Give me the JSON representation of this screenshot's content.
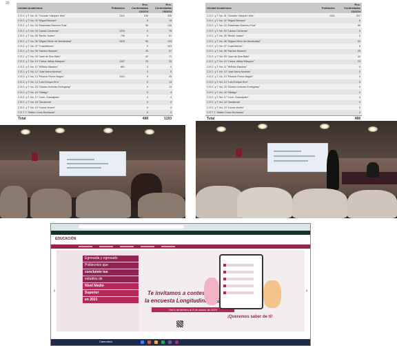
{
  "page_number": "20",
  "table_left": {
    "headers": [
      "Unidad Académica",
      "Población",
      "Enc. Contestadas 12/2/24",
      "Enc. Contestadas 19/2/24"
    ],
    "rows": [
      [
        "C.E.C. y T. No. 01 \"Gonzalo Vázquez Vela\"",
        "1341",
        "249",
        "335"
      ],
      [
        "C.E.C. y T. No. 02 \"Miguel Bernard\"",
        "",
        "8",
        "18"
      ],
      [
        "C.E.C. y T. No. 03 \"Estanislao Ramírez Ruiz\"",
        "",
        "96",
        "145"
      ],
      [
        "C.E.C. y T. No. 04 \"Lázaro Cárdenas\"",
        "1233",
        "0",
        "78"
      ],
      [
        "C.E.C. y T. No. 05 \"Benito Juárez\"",
        "795",
        "0",
        "51"
      ],
      [
        "C.E.C. y T. No. 06 \"Miguel Othón de Mendizábal\"",
        "1029",
        "90",
        "133"
      ],
      [
        "C.E.C. y T. No. 07 \"Cuauhtémoc\"",
        "",
        "0",
        "103"
      ],
      [
        "C.E.C. y T. No. 08 \"Narciso Bassols\"",
        "",
        "25",
        "57"
      ],
      [
        "C.E.C. y T. No. 09 \"Juan de Dios Bátiz\"",
        "",
        "42",
        "71"
      ],
      [
        "C.E.C. y T. No. 10 \"Carlos Vallejo Márquez\"",
        "1197",
        "23",
        "25"
      ],
      [
        "C.E.C. y T. No. 11 \"Wilfrido Massieu\"",
        "861",
        "0",
        "0"
      ],
      [
        "C.E.C. y T. No. 12 \"José María Morelos\"",
        "",
        "0",
        "0"
      ],
      [
        "C.E.C. y T. No. 13 \"Ricardo Flores Magón\"",
        "1121",
        "0",
        "29"
      ],
      [
        "C.E.C. y T. No. 14 \"Luis Enrique Erro\"",
        "",
        "0",
        "13"
      ],
      [
        "C.E.C. y T. No. 15 \"Diódoro Antúnez Echegaray\"",
        "",
        "0",
        "13"
      ],
      [
        "C.E.C. y T. No. 16 \"Hidalgo\"",
        "",
        "0",
        "4"
      ],
      [
        "C.E.C. y T. No. 17 \"León, Guanajuato\"",
        "",
        "4",
        "4"
      ],
      [
        "C.E.C. y T. No. 18 \"Zacatecas\"",
        "",
        "0",
        "0"
      ],
      [
        "C.E.C. y T. No. 19 \"Leona Vicario\"",
        "",
        "0",
        "0"
      ],
      [
        "C.E.T. 1 \"Walter Cross Buchanan\"",
        "",
        "0",
        "0"
      ]
    ],
    "total_label": "Total",
    "total_values": [
      "",
      "488",
      "1193"
    ]
  },
  "table_right": {
    "headers": [
      "Unidad Académica",
      "Población",
      "Enc. Contestadas 12/2/24"
    ],
    "rows": [
      [
        "C.E.C. y T. No. 01 \"Gonzalo Vázquez Vela\"",
        "1341",
        "237"
      ],
      [
        "C.E.C. y T. No. 02 \"Miguel Bernard\"",
        "",
        "8"
      ],
      [
        "C.E.C. y T. No. 03 \"Estanislao Ramírez Ruiz\"",
        "",
        "96"
      ],
      [
        "C.E.C. y T. No. 04 \"Lázaro Cárdenas\"",
        "",
        "0"
      ],
      [
        "C.E.C. y T. No. 05 \"Benito Juárez\"",
        "",
        "0"
      ],
      [
        "C.E.C. y T. No. 06 \"Miguel Othón de Mendizábal\"",
        "",
        "90"
      ],
      [
        "C.E.C. y T. No. 07 \"Cuauhtémoc\"",
        "",
        "0"
      ],
      [
        "C.E.C. y T. No. 08 \"Narciso Bassols\"",
        "",
        "25"
      ],
      [
        "C.E.C. y T. No. 09 \"Juan de Dios Bátiz\"",
        "",
        "42"
      ],
      [
        "C.E.C. y T. No. 10 \"Carlos Vallejo Márquez\"",
        "",
        "23"
      ],
      [
        "C.E.C. y T. No. 11 \"Wilfrido Massieu\"",
        "",
        "0"
      ],
      [
        "C.E.C. y T. No. 12 \"José María Morelos\"",
        "",
        "0"
      ],
      [
        "C.E.C. y T. No. 13 \"Ricardo Flores Magón\"",
        "",
        "0"
      ],
      [
        "C.E.C. y T. No. 14 \"Luis Enrique Erro\"",
        "",
        "0"
      ],
      [
        "C.E.C. y T. No. 15 \"Diódoro Antúnez Echegaray\"",
        "",
        "0"
      ],
      [
        "C.E.C. y T. No. 16 \"Hidalgo\"",
        "",
        "0"
      ],
      [
        "C.E.C. y T. No. 17 \"León, Guanajuato\"",
        "",
        "4"
      ],
      [
        "C.E.C. y T. No. 18 \"Zacatecas\"",
        "",
        "0"
      ],
      [
        "C.E.C. y T. No. 19 \"Leona Vicario\"",
        "",
        "0"
      ],
      [
        "C.E.T. 1 \"Walter Cross Buchanan\"",
        "",
        "0"
      ]
    ],
    "total_label": "Total",
    "total_values": [
      "",
      "488"
    ]
  },
  "browser": {
    "logo": "EDUCACIÓN",
    "banner": {
      "pill_lines": [
        "Egresada y egresado",
        "Politécnico que",
        "concluiste tus",
        "estudios de"
      ],
      "highlight_1": "Nivel Medio",
      "highlight_2": "Superior",
      "year": "en 2021",
      "headline_1": "Te invitamos a contestar",
      "headline_2": "la encuesta Longitudinal 2024",
      "dates": "Del 6 de febrero al 8 de marzo de 2024",
      "closing": "¡Queremos saber de ti!"
    },
    "taskbar_label": "Calendario"
  },
  "colors": {
    "gob_green": "#13322b",
    "guinda": "#9d2449",
    "banner_accent": "#b4285a"
  }
}
